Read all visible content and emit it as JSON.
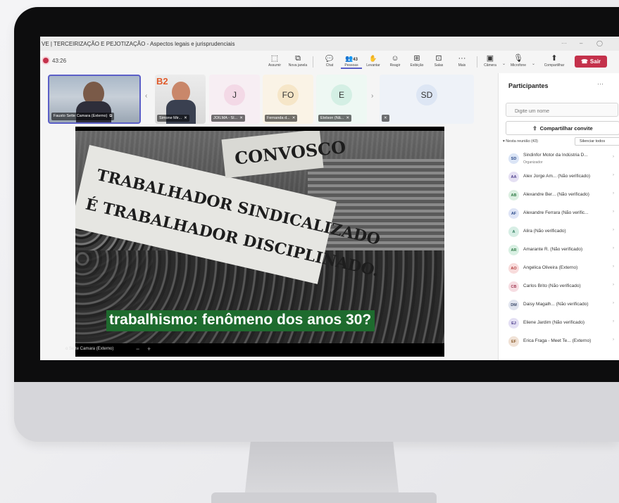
{
  "window": {
    "title": "VE | TERCEIRIZAÇÃO E PEJOTIZAÇÃO - Aspectos legais e jurisprudenciais",
    "controls": [
      "···",
      "–",
      "◯"
    ]
  },
  "toolbar": {
    "recording_time": "43:26",
    "buttons": [
      {
        "label": "Assumir",
        "icon": "take-control-icon",
        "glyph": "⬚"
      },
      {
        "label": "Nova janela",
        "icon": "new-window-icon",
        "glyph": "⧉"
      },
      {
        "label": "Chat",
        "icon": "chat-icon",
        "glyph": "💬"
      },
      {
        "label": "Pessoas",
        "icon": "people-icon",
        "glyph": "👥",
        "badge": "43"
      },
      {
        "label": "Levantar",
        "icon": "raise-hand-icon",
        "glyph": "✋"
      },
      {
        "label": "Reagir",
        "icon": "react-icon",
        "glyph": "☺"
      },
      {
        "label": "Exibição",
        "icon": "view-icon",
        "glyph": "⊞"
      },
      {
        "label": "Salas",
        "icon": "rooms-icon",
        "glyph": "⊡"
      },
      {
        "label": "Mais",
        "icon": "more-icon",
        "glyph": "···"
      }
    ],
    "camera_label": "Câmera",
    "microphone_label": "Microfone",
    "share_label": "Compartilhar",
    "leave_label": "Sair"
  },
  "participants_strip": [
    {
      "name": "Fausto Sette Camara (Externo)",
      "type": "video"
    },
    {
      "name": "Simone Mir...",
      "type": "video"
    },
    {
      "name": "JOILMA - SI...",
      "initials": "J",
      "color": "#f3d9e6"
    },
    {
      "name": "Fernanda d...",
      "initials": "FO",
      "color": "#f6e6c8"
    },
    {
      "name": "Etelson (Nã...",
      "initials": "E",
      "color": "#d4efe4"
    },
    {
      "name": "",
      "initials": "SD",
      "color": "#dde6f4"
    }
  ],
  "shared_content": {
    "banner_texts": [
      "TRABALHADOR SINDICALIZADO",
      "É TRABALHADOR DISCIPLINADO.",
      "CONVOSCO"
    ],
    "caption": "trabalhismo: fenômeno dos anos 30?",
    "presenter_label": "o Sette Camara (Externo)"
  },
  "panel": {
    "title": "Participantes",
    "search_placeholder": "Digite um nome",
    "share_invite_label": "Compartilhar convite",
    "section_label": "Nesta reunião (43)",
    "mute_all_label": "Silenciar todos",
    "participants": [
      {
        "initials": "SD",
        "name": "Sindinfor Motor da Indústria D...",
        "role": "Organizador",
        "bg": "#dbe5f6",
        "fg": "#2b4a8a"
      },
      {
        "initials": "AA",
        "name": "Alex Jorge Am... (Não verificado)",
        "bg": "#e5e0f3",
        "fg": "#4a3b8a"
      },
      {
        "initials": "AB",
        "name": "Alexandre Ber... (Não verificado)",
        "bg": "#dcefe2",
        "fg": "#2e7a45"
      },
      {
        "initials": "AF",
        "name": "Alexandre Ferrara (Não verific...",
        "bg": "#dfe5f6",
        "fg": "#2b4a8a"
      },
      {
        "initials": "A",
        "name": "Alira (Não verificado)",
        "bg": "#d7eee5",
        "fg": "#2b7a5a"
      },
      {
        "initials": "AR",
        "name": "Amarante R. (Não verificado)",
        "bg": "#d9f0e3",
        "fg": "#2e7a45"
      },
      {
        "initials": "AO",
        "name": "Angelica Oliveira (Externo)",
        "bg": "#f8dcdc",
        "fg": "#b23b3b"
      },
      {
        "initials": "CB",
        "name": "Carlos Brito (Não verificado)",
        "bg": "#f6dde2",
        "fg": "#a23b55"
      },
      {
        "initials": "DM",
        "name": "Daisy Magalh... (Não verificado)",
        "bg": "#e0e4ee",
        "fg": "#3b4a6a"
      },
      {
        "initials": "EJ",
        "name": "Eliene Jardim (Não verificado)",
        "bg": "#e4e0f4",
        "fg": "#4a3b8a"
      },
      {
        "initials": "EF",
        "name": "Erica Fraga - Meet Te... (Externo)",
        "bg": "#f0e2d6",
        "fg": "#8a5a2b"
      }
    ]
  }
}
